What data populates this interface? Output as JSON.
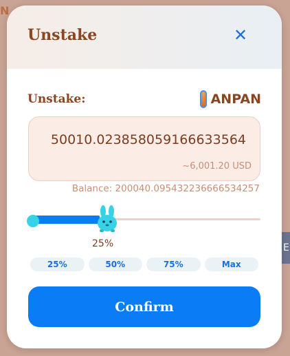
{
  "background": {
    "left_hint": "N",
    "right_hint": "E"
  },
  "modal": {
    "title": "Unstake",
    "close_icon": "close-icon",
    "unstake_label": "Unstake:",
    "token": {
      "icon": "anpan-token-icon",
      "symbol": "ANPAN"
    },
    "amount": {
      "value": "50010.023858059166633564",
      "usd": "~6,001.20 USD"
    },
    "balance": "Balance: 200040.095432236666534257",
    "slider": {
      "percent": 25,
      "percent_label": "25%",
      "thumb_icon": "bunny-thumb-icon"
    },
    "quick_buttons": [
      "25%",
      "50%",
      "75%",
      "Max"
    ],
    "confirm_label": "Confirm"
  },
  "colors": {
    "accent": "#0a7cf6",
    "title": "#8a4522",
    "muted": "#c88e74",
    "input_bg": "#fbece6",
    "thumb": "#37d2e6"
  }
}
